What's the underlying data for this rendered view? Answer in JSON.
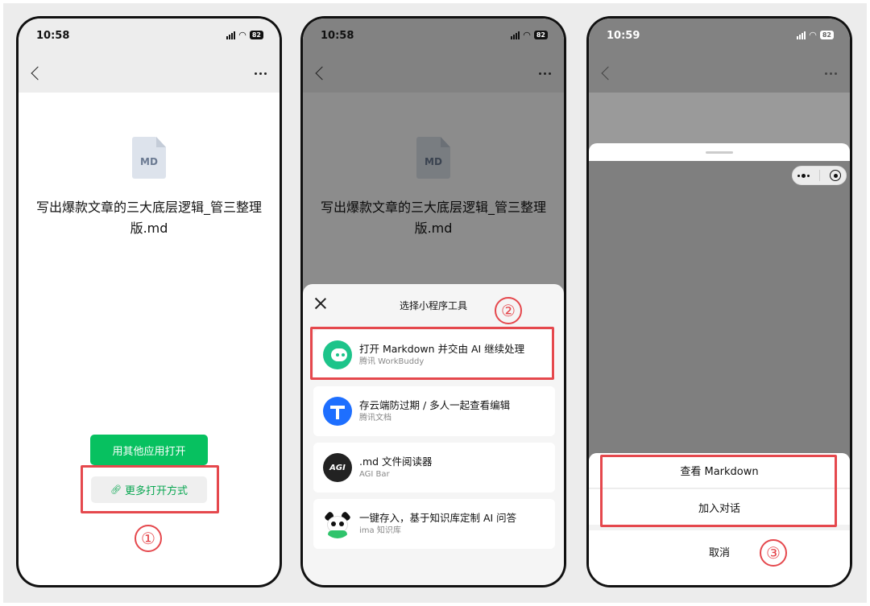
{
  "phone1": {
    "status": {
      "time": "10:58",
      "battery": "82"
    },
    "file": {
      "ext": "MD",
      "name": "写出爆款文章的三大底层逻辑_管三整理版.md"
    },
    "open_other_app": "用其他应用打开",
    "more_open_methods": "更多打开方式",
    "step": "①"
  },
  "phone2": {
    "status": {
      "time": "10:58",
      "battery": "82"
    },
    "file": {
      "ext": "MD",
      "name": "写出爆款文章的三大底层逻辑_管三整理版.md"
    },
    "sheet_title": "选择小程序工具",
    "step": "②",
    "tools": [
      {
        "title": "打开 Markdown 并交由 AI 继续处理",
        "sub": "腾讯 WorkBuddy",
        "logo": "workbuddy-logo",
        "color": "#1dc48a"
      },
      {
        "title": "存云端防过期 / 多人一起查看编辑",
        "sub": "腾讯文档",
        "logo": "tencent-docs-logo",
        "color": "#1e6fff"
      },
      {
        "title": ".md 文件阅读器",
        "sub": "AGI Bar",
        "logo": "agi-bar-logo",
        "logo_text": "AGI",
        "color": "#222222"
      },
      {
        "title": "一键存入，基于知识库定制 AI 问答",
        "sub": "ima 知识库",
        "logo": "ima-panda-logo",
        "color": "#2fc36b"
      }
    ]
  },
  "phone3": {
    "status": {
      "time": "10:59",
      "battery": "82"
    },
    "actions": [
      "查看 Markdown",
      "加入对话"
    ],
    "cancel": "取消",
    "step": "③"
  },
  "colors": {
    "accent_green": "#07c160",
    "highlight_red": "#e5484d"
  }
}
